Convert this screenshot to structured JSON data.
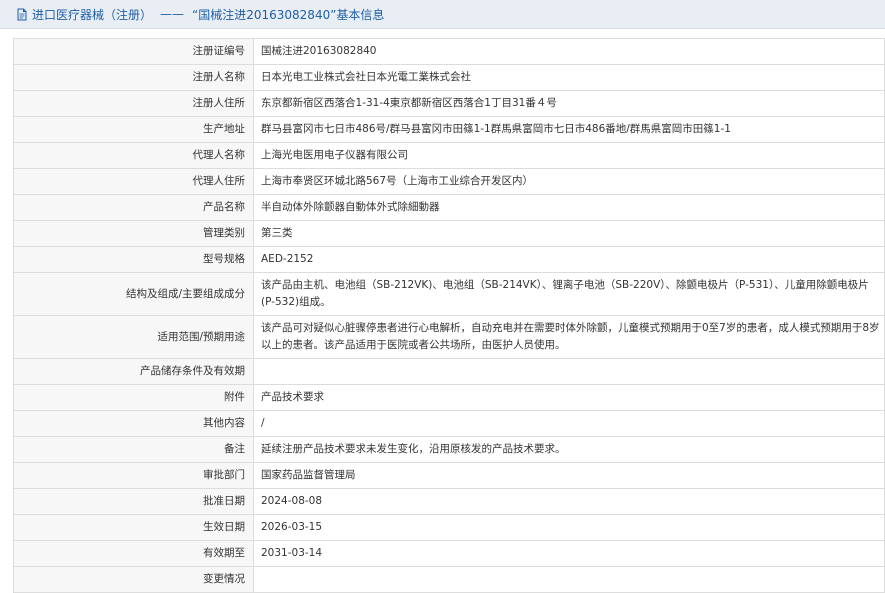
{
  "header": {
    "title": "进口医疗器械（注册）",
    "separator": "——",
    "subtitle": "“国械注进20163082840”基本信息"
  },
  "fields": [
    {
      "label": "注册证编号",
      "value": "国械注进20163082840"
    },
    {
      "label": "注册人名称",
      "value": "日本光电工业株式会社日本光電工業株式会社"
    },
    {
      "label": "注册人住所",
      "value": "东京都新宿区西落合1-31-4東京都新宿区西落合1丁目31番４号"
    },
    {
      "label": "生产地址",
      "value": "群马县富冈市七日市486号/群马县富冈市田篠1-1群馬県富岡市七日市486番地/群馬県富岡市田篠1-1"
    },
    {
      "label": "代理人名称",
      "value": "上海光电医用电子仪器有限公司"
    },
    {
      "label": "代理人住所",
      "value": "上海市奉贤区环城北路567号（上海市工业综合开发区内）"
    },
    {
      "label": "产品名称",
      "value": "半自动体外除颤器自動体外式除細動器"
    },
    {
      "label": "管理类别",
      "value": "第三类"
    },
    {
      "label": "型号规格",
      "value": "AED-2152"
    },
    {
      "label": "结构及组成/主要组成成分",
      "value": "该产品由主机、电池组（SB-212VK)、电池组（SB-214VK）、锂离子电池（SB-220V）、除颤电极片（P-531）、儿童用除颤电极片(P-532)组成。"
    },
    {
      "label": "适用范围/预期用途",
      "value": "该产品可对疑似心脏骤停患者进行心电解析，自动充电并在需要时体外除颤，儿童模式预期用于0至7岁的患者，成人模式预期用于8岁以上的患者。该产品适用于医院或者公共场所，由医护人员使用。"
    },
    {
      "label": "产品储存条件及有效期",
      "value": ""
    },
    {
      "label": "附件",
      "value": "产品技术要求"
    },
    {
      "label": "其他内容",
      "value": "/"
    },
    {
      "label": "备注",
      "value": "延续注册产品技术要求未发生变化，沿用原核发的产品技术要求。"
    },
    {
      "label": "审批部门",
      "value": "国家药品监督管理局"
    },
    {
      "label": "批准日期",
      "value": "2024-08-08"
    },
    {
      "label": "生效日期",
      "value": "2026-03-15"
    },
    {
      "label": "有效期至",
      "value": "2031-03-14"
    },
    {
      "label": "变更情况",
      "value": ""
    }
  ]
}
